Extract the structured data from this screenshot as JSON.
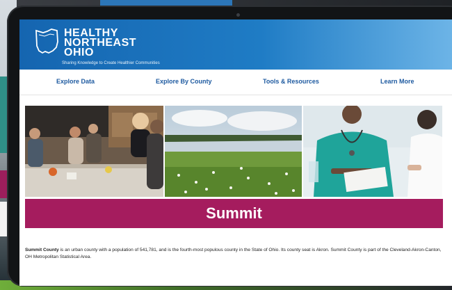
{
  "site": {
    "brand_line1": "HEALTHY",
    "brand_line2": "NORTHEAST",
    "brand_line3": "OHIO",
    "tagline": "Sharing Knowledge to Create Healthier Communities"
  },
  "nav": {
    "items": [
      {
        "label": "Explore Data"
      },
      {
        "label": "Explore By County"
      },
      {
        "label": "Tools & Resources"
      },
      {
        "label": "Learn More"
      }
    ]
  },
  "photos": [
    {
      "subject": "family-in-kitchen"
    },
    {
      "subject": "river-meadow-landscape"
    },
    {
      "subject": "doctor-patient-consultation"
    }
  ],
  "county": {
    "title": "Summit",
    "name_bold": "Summit County",
    "description": " is an urban county with a population of 541,781, and is the fourth-most populous county in the State of Ohio. Its county seat is Akron. Summit County is part of the Cleveland-Akron-Canton, OH Metropolitan Statistical Area."
  },
  "colors": {
    "header_blue": "#1565b0",
    "nav_link": "#1e5aa0",
    "banner_magenta": "#a51c5e"
  }
}
